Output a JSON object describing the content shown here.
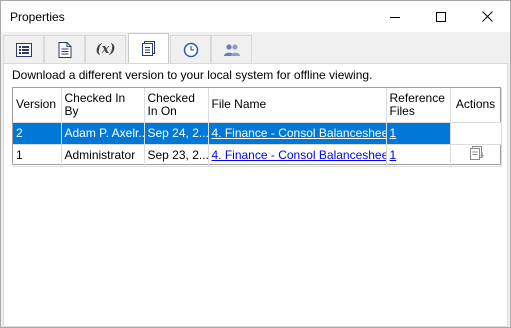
{
  "window": {
    "title": "Properties"
  },
  "tabs": [
    {
      "icon": "list-icon"
    },
    {
      "icon": "document-icon"
    },
    {
      "icon": "variable-icon",
      "label": "(x)"
    },
    {
      "icon": "versions-icon",
      "active": true
    },
    {
      "icon": "clock-icon"
    },
    {
      "icon": "users-icon"
    }
  ],
  "description": "Download a different version to your local system for offline viewing.",
  "table": {
    "headers": {
      "version": "Version",
      "checked_in_by": "Checked In By",
      "checked_in_on": "Checked In On",
      "file_name": "File Name",
      "reference_files": "Reference Files",
      "actions": "Actions"
    },
    "rows": [
      {
        "version": "2",
        "checked_in_by": "Adam P. Axelr...",
        "checked_in_on": "Sep 24, 2...",
        "file_name": "4. Finance - Consol Balancesheet...",
        "reference_files": "1",
        "selected": true,
        "action_icon": null
      },
      {
        "version": "1",
        "checked_in_by": "Administrator",
        "checked_in_on": "Sep 23, 2...",
        "file_name": "4. Finance - Consol Balancesheet...",
        "reference_files": "1",
        "selected": false,
        "action_icon": "download-version-icon"
      }
    ]
  },
  "colors": {
    "selection": "#0078d7",
    "link": "#0000ff"
  }
}
